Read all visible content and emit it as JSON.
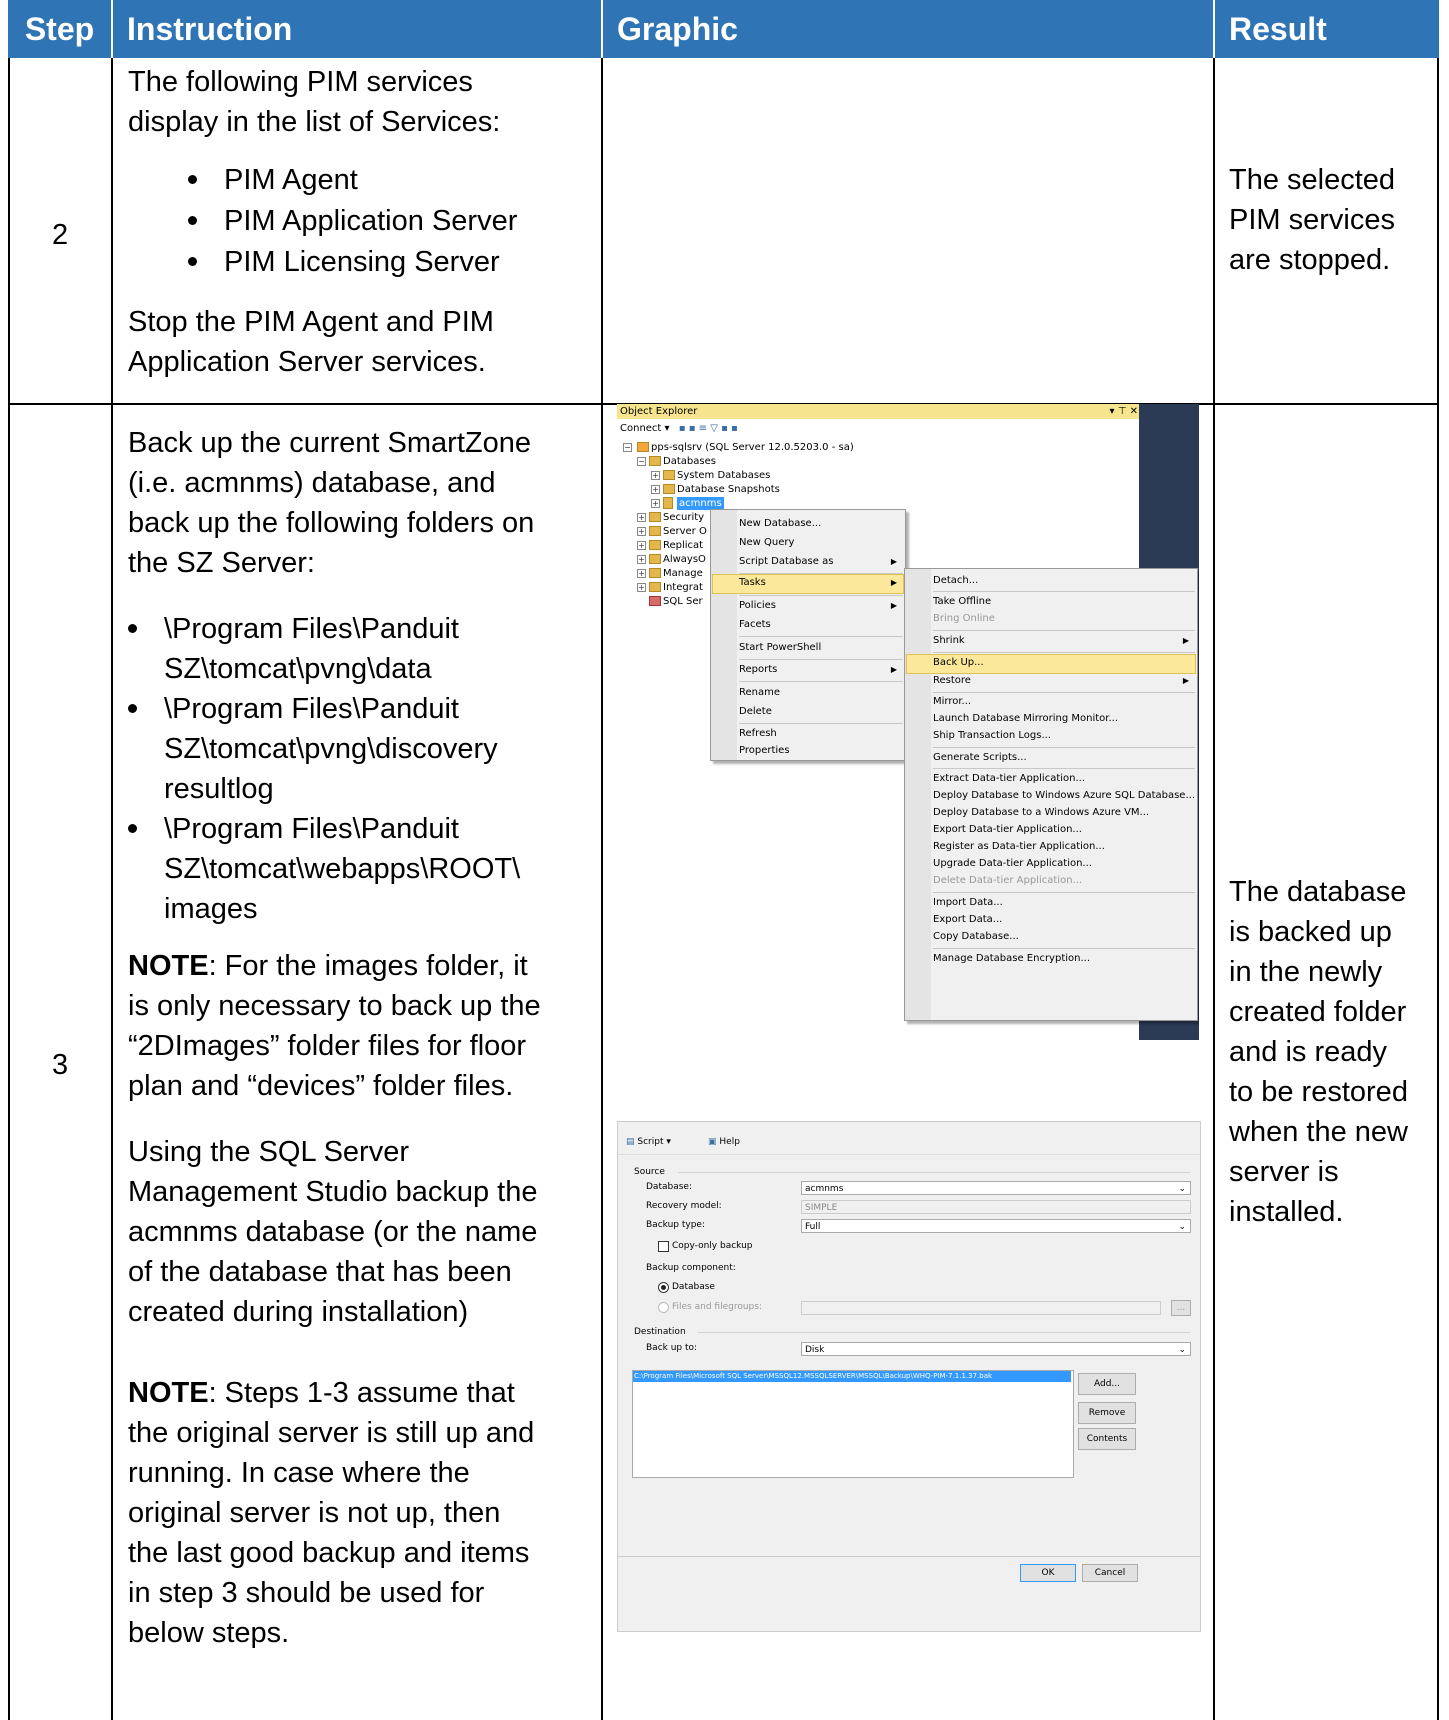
{
  "header": {
    "step": "Step",
    "instruction": "Instruction",
    "graphic": "Graphic",
    "result": "Result"
  },
  "colors": {
    "header_bg": "#2f74b5",
    "header_text": "#ffffff"
  },
  "row2": {
    "step": "2",
    "intro_1": "The following PIM services",
    "intro_2": "display in the list of Services:",
    "bullets": [
      "PIM Agent",
      "PIM Application Server",
      "PIM Licensing Server"
    ],
    "outro_1": "Stop the PIM Agent and PIM",
    "outro_2": "Application Server services.",
    "result": [
      "The selected",
      "PIM services",
      "are stopped."
    ]
  },
  "row3": {
    "step": "3",
    "intro": [
      "Back up the current SmartZone",
      "(i.e. acmnms) database, and",
      "back up the following folders on",
      "the SZ Server:"
    ],
    "folders": [
      [
        "\\Program Files\\Panduit",
        "SZ\\tomcat\\pvng\\data"
      ],
      [
        "\\Program Files\\Panduit",
        "SZ\\tomcat\\pvng\\discovery",
        "resultlog"
      ],
      [
        "\\Program Files\\Panduit",
        "SZ\\tomcat\\webapps\\ROOT\\",
        "images"
      ]
    ],
    "note1_label": "NOTE",
    "note1": [
      ": For the images folder, it",
      "is only necessary to back up the",
      "“2DImages” folder files for floor",
      "plan and “devices” folder files."
    ],
    "ssms": [
      "Using the SQL Server",
      "Management Studio backup the",
      "acmnms database (or the name",
      "of the database that has been",
      "created during installation)"
    ],
    "note2_label": "NOTE",
    "note2": [
      ": Steps 1-3 assume that",
      "the original server is still up and",
      "running. In case where the",
      "original server is not up, then",
      "the last good backup and items",
      "in step 3 should be used for",
      "below steps."
    ],
    "result": [
      "The database",
      "is backed up",
      "in the newly",
      "created folder",
      "and is ready",
      "to be restored",
      "when the new",
      "server is",
      "installed."
    ]
  },
  "object_explorer": {
    "title": "Object Explorer",
    "title_controls": "▾ ⊤ ✕",
    "connect": "Connect ▾",
    "server": "pps-sqlsrv (SQL Server 12.0.5203.0 - sa)",
    "tree": [
      "Databases",
      "System Databases",
      "Database Snapshots",
      "acmnms",
      "Security",
      "Server O",
      "Replicat",
      "AlwaysO",
      "Manage",
      "Integrat",
      "SQL Ser"
    ],
    "context_menu": [
      "New Database...",
      "New Query",
      "Script Database as",
      "Tasks",
      "Policies",
      "Facets",
      "Start PowerShell",
      "Reports",
      "Rename",
      "Delete",
      "Refresh",
      "Properties"
    ],
    "tasks_menu": [
      "Detach...",
      "Take Offline",
      "Bring Online",
      "Shrink",
      "Back Up...",
      "Restore",
      "Mirror...",
      "Launch Database Mirroring Monitor...",
      "Ship Transaction Logs...",
      "Generate Scripts...",
      "Extract Data-tier Application...",
      "Deploy Database to Windows Azure SQL Database...",
      "Deploy Database to a Windows Azure VM...",
      "Export Data-tier Application...",
      "Register as Data-tier Application...",
      "Upgrade Data-tier Application...",
      "Delete Data-tier Application...",
      "Import Data...",
      "Export Data...",
      "Copy Database...",
      "Manage Database Encryption..."
    ]
  },
  "backup_dialog": {
    "toolbar_script": "Script",
    "toolbar_help": "Help",
    "source": "Source",
    "database_label": "Database:",
    "database_value": "acmnms",
    "recovery_label": "Recovery model:",
    "recovery_value": "SIMPLE",
    "type_label": "Backup type:",
    "type_value": "Full",
    "copy_only": "Copy-only backup",
    "component": "Backup component:",
    "opt_database": "Database",
    "opt_files": "Files and filegroups:",
    "destination": "Destination",
    "backup_to_label": "Back up to:",
    "backup_to_value": "Disk",
    "path": "C:\\Program Files\\Microsoft SQL Server\\MSSQL12.MSSQLSERVER\\MSSQL\\Backup\\WHQ-PIM-7.1.1.37.bak",
    "add": "Add...",
    "remove": "Remove",
    "contents": "Contents",
    "ok": "OK",
    "cancel": "Cancel",
    "ellipsis": "..."
  }
}
